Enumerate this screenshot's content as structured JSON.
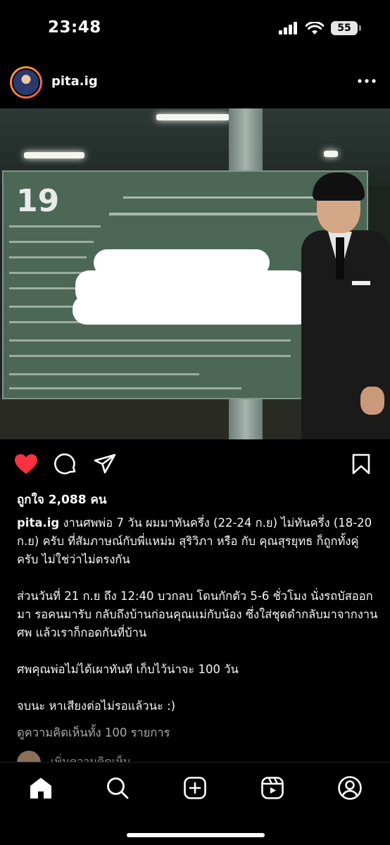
{
  "status_bar": {
    "time": "23:48",
    "battery": "55"
  },
  "post": {
    "username": "pita.ig",
    "photo_banner_number": "19",
    "likes": "ถูกใจ 2,088 คน",
    "caption_paragraphs": [
      "งานศพพ่อ 7 วัน ผมมาทันครึ่ง (22-24 ก.ย) ไม่ทันครึ่ง (18-20 ก.ย) ครับ ที่สัมภาษณ์กับพี่แหม่ม สุริวิภา หรือ กับ คุณสุรยุทธ ก็ถูกทั้งคู่ครับ ไม่ใช่ว่าไม่ตรงกัน",
      "ส่วนวันที่ 21 ก.ย ถึง 12:40 บวกลบ โดนกักตัว 5-6 ชั่วโมง นั่งรถบัสออกมา รอคนมารับ กลับถึงบ้านก่อนคุณแม่กับน้อง ซึ่งใส่ชุดดำกลับมาจากงานศพ แล้วเราก็กอดกันที่บ้าน",
      "ศพคุณพ่อไม่ได้เผาทันที เก็บไว้น่าจะ 100 วัน",
      "จบนะ หาเสียงต่อไม่รอแล้วนะ :)"
    ],
    "view_comments": "ดูความคิดเห็นทั้ง 100 รายการ",
    "add_comment_placeholder": "เพิ่มความคิดเห็น..."
  },
  "colors": {
    "like_red": "#ff3040",
    "background": "#000000",
    "secondary_text": "#a8a8a8"
  },
  "icons": {
    "actions": [
      "heart-icon",
      "comment-icon",
      "share-icon",
      "bookmark-icon"
    ],
    "nav": [
      "home-icon",
      "search-icon",
      "create-icon",
      "reels-icon",
      "profile-icon"
    ]
  }
}
